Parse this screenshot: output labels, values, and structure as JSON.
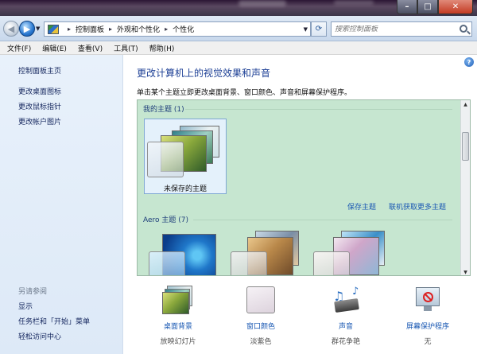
{
  "window": {
    "controls": {
      "minimize": "–",
      "maximize": "□",
      "close": "✕"
    }
  },
  "address": {
    "crumbs": [
      "控制面板",
      "外观和个性化",
      "个性化"
    ],
    "search_placeholder": "搜索控制面板"
  },
  "menu": [
    "文件(F)",
    "编辑(E)",
    "查看(V)",
    "工具(T)",
    "帮助(H)"
  ],
  "left": {
    "home": "控制面板主页",
    "tasks": [
      "更改桌面图标",
      "更改鼠标指针",
      "更改帐户图片"
    ],
    "see_also_title": "另请参阅",
    "see_also": [
      "显示",
      "任务栏和「开始」菜单",
      "轻松访问中心"
    ]
  },
  "main": {
    "title": "更改计算机上的视觉效果和声音",
    "subtitle": "单击某个主题立即更改桌面背景、窗口颜色、声音和屏幕保护程序。",
    "my_themes_header": "我的主题 (1)",
    "unsaved_theme": "未保存的主题",
    "save_theme": "保存主题",
    "get_more": "联机获取更多主题",
    "aero_header": "Aero 主题 (7)"
  },
  "bottom": [
    {
      "label": "桌面背景",
      "value": "放映幻灯片",
      "icon": "desktop-background-icon"
    },
    {
      "label": "窗口颜色",
      "value": "淡紫色",
      "icon": "window-color-icon"
    },
    {
      "label": "声音",
      "value": "群花争艳",
      "icon": "sound-icon"
    },
    {
      "label": "屏幕保护程序",
      "value": "无",
      "icon": "screensaver-icon"
    }
  ],
  "colors": {
    "panel_bg": "#c6e6d0",
    "link": "#1a58b3",
    "title": "#1c3f95",
    "left_bg": "#e2edf9"
  }
}
